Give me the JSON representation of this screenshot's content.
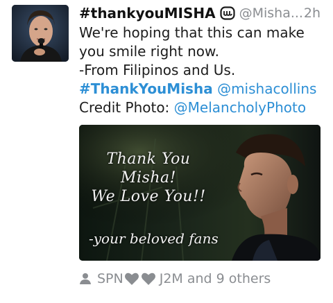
{
  "author": {
    "display_name": "#thankyouMISHA",
    "handle": "@Misha...",
    "time": "2h",
    "avatar_icon": "profile-photo"
  },
  "body": {
    "line1": "We're hoping that this can make",
    "line2": "you smile right now.",
    "line3": "-From Filipinos and Us.",
    "hashtag": "#ThankYouMisha",
    "mention1": "@mishacollins",
    "credit_prefix": "Credit Photo:",
    "mention2": "@MelancholyPhoto"
  },
  "photo": {
    "caption": [
      "Thank You",
      "Misha!",
      "We Love You!!"
    ],
    "signature": "-your beloved fans"
  },
  "social_context": {
    "prefix": "SPN",
    "suffix": "J2M and 9 others",
    "icons": [
      "person-icon",
      "heart-icon",
      "heart-icon"
    ]
  },
  "colors": {
    "link": "#2d8fd5",
    "meta": "#8a8d91",
    "text": "#1c1c1c"
  }
}
